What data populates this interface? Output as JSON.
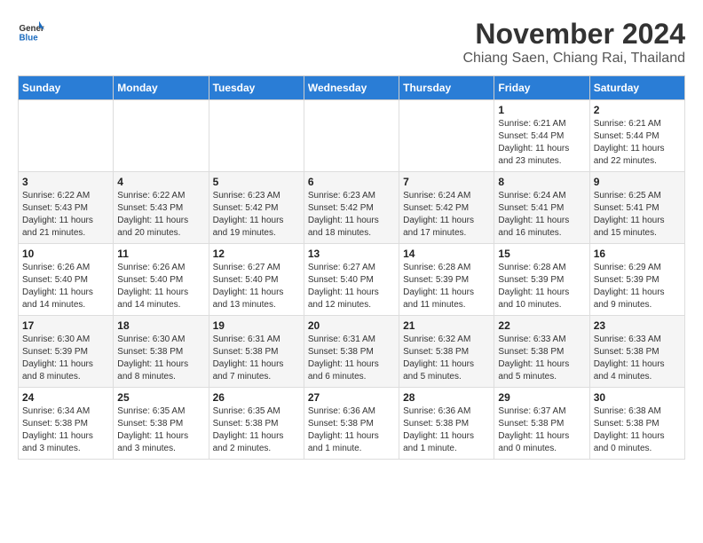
{
  "header": {
    "logo": {
      "general": "General",
      "blue": "Blue"
    },
    "title": "November 2024",
    "location": "Chiang Saen, Chiang Rai, Thailand"
  },
  "weekdays": [
    "Sunday",
    "Monday",
    "Tuesday",
    "Wednesday",
    "Thursday",
    "Friday",
    "Saturday"
  ],
  "weeks": [
    [
      {
        "day": "",
        "info": ""
      },
      {
        "day": "",
        "info": ""
      },
      {
        "day": "",
        "info": ""
      },
      {
        "day": "",
        "info": ""
      },
      {
        "day": "",
        "info": ""
      },
      {
        "day": "1",
        "info": "Sunrise: 6:21 AM\nSunset: 5:44 PM\nDaylight: 11 hours and 23 minutes."
      },
      {
        "day": "2",
        "info": "Sunrise: 6:21 AM\nSunset: 5:44 PM\nDaylight: 11 hours and 22 minutes."
      }
    ],
    [
      {
        "day": "3",
        "info": "Sunrise: 6:22 AM\nSunset: 5:43 PM\nDaylight: 11 hours and 21 minutes."
      },
      {
        "day": "4",
        "info": "Sunrise: 6:22 AM\nSunset: 5:43 PM\nDaylight: 11 hours and 20 minutes."
      },
      {
        "day": "5",
        "info": "Sunrise: 6:23 AM\nSunset: 5:42 PM\nDaylight: 11 hours and 19 minutes."
      },
      {
        "day": "6",
        "info": "Sunrise: 6:23 AM\nSunset: 5:42 PM\nDaylight: 11 hours and 18 minutes."
      },
      {
        "day": "7",
        "info": "Sunrise: 6:24 AM\nSunset: 5:42 PM\nDaylight: 11 hours and 17 minutes."
      },
      {
        "day": "8",
        "info": "Sunrise: 6:24 AM\nSunset: 5:41 PM\nDaylight: 11 hours and 16 minutes."
      },
      {
        "day": "9",
        "info": "Sunrise: 6:25 AM\nSunset: 5:41 PM\nDaylight: 11 hours and 15 minutes."
      }
    ],
    [
      {
        "day": "10",
        "info": "Sunrise: 6:26 AM\nSunset: 5:40 PM\nDaylight: 11 hours and 14 minutes."
      },
      {
        "day": "11",
        "info": "Sunrise: 6:26 AM\nSunset: 5:40 PM\nDaylight: 11 hours and 14 minutes."
      },
      {
        "day": "12",
        "info": "Sunrise: 6:27 AM\nSunset: 5:40 PM\nDaylight: 11 hours and 13 minutes."
      },
      {
        "day": "13",
        "info": "Sunrise: 6:27 AM\nSunset: 5:40 PM\nDaylight: 11 hours and 12 minutes."
      },
      {
        "day": "14",
        "info": "Sunrise: 6:28 AM\nSunset: 5:39 PM\nDaylight: 11 hours and 11 minutes."
      },
      {
        "day": "15",
        "info": "Sunrise: 6:28 AM\nSunset: 5:39 PM\nDaylight: 11 hours and 10 minutes."
      },
      {
        "day": "16",
        "info": "Sunrise: 6:29 AM\nSunset: 5:39 PM\nDaylight: 11 hours and 9 minutes."
      }
    ],
    [
      {
        "day": "17",
        "info": "Sunrise: 6:30 AM\nSunset: 5:39 PM\nDaylight: 11 hours and 8 minutes."
      },
      {
        "day": "18",
        "info": "Sunrise: 6:30 AM\nSunset: 5:38 PM\nDaylight: 11 hours and 8 minutes."
      },
      {
        "day": "19",
        "info": "Sunrise: 6:31 AM\nSunset: 5:38 PM\nDaylight: 11 hours and 7 minutes."
      },
      {
        "day": "20",
        "info": "Sunrise: 6:31 AM\nSunset: 5:38 PM\nDaylight: 11 hours and 6 minutes."
      },
      {
        "day": "21",
        "info": "Sunrise: 6:32 AM\nSunset: 5:38 PM\nDaylight: 11 hours and 5 minutes."
      },
      {
        "day": "22",
        "info": "Sunrise: 6:33 AM\nSunset: 5:38 PM\nDaylight: 11 hours and 5 minutes."
      },
      {
        "day": "23",
        "info": "Sunrise: 6:33 AM\nSunset: 5:38 PM\nDaylight: 11 hours and 4 minutes."
      }
    ],
    [
      {
        "day": "24",
        "info": "Sunrise: 6:34 AM\nSunset: 5:38 PM\nDaylight: 11 hours and 3 minutes."
      },
      {
        "day": "25",
        "info": "Sunrise: 6:35 AM\nSunset: 5:38 PM\nDaylight: 11 hours and 3 minutes."
      },
      {
        "day": "26",
        "info": "Sunrise: 6:35 AM\nSunset: 5:38 PM\nDaylight: 11 hours and 2 minutes."
      },
      {
        "day": "27",
        "info": "Sunrise: 6:36 AM\nSunset: 5:38 PM\nDaylight: 11 hours and 1 minute."
      },
      {
        "day": "28",
        "info": "Sunrise: 6:36 AM\nSunset: 5:38 PM\nDaylight: 11 hours and 1 minute."
      },
      {
        "day": "29",
        "info": "Sunrise: 6:37 AM\nSunset: 5:38 PM\nDaylight: 11 hours and 0 minutes."
      },
      {
        "day": "30",
        "info": "Sunrise: 6:38 AM\nSunset: 5:38 PM\nDaylight: 11 hours and 0 minutes."
      }
    ]
  ]
}
